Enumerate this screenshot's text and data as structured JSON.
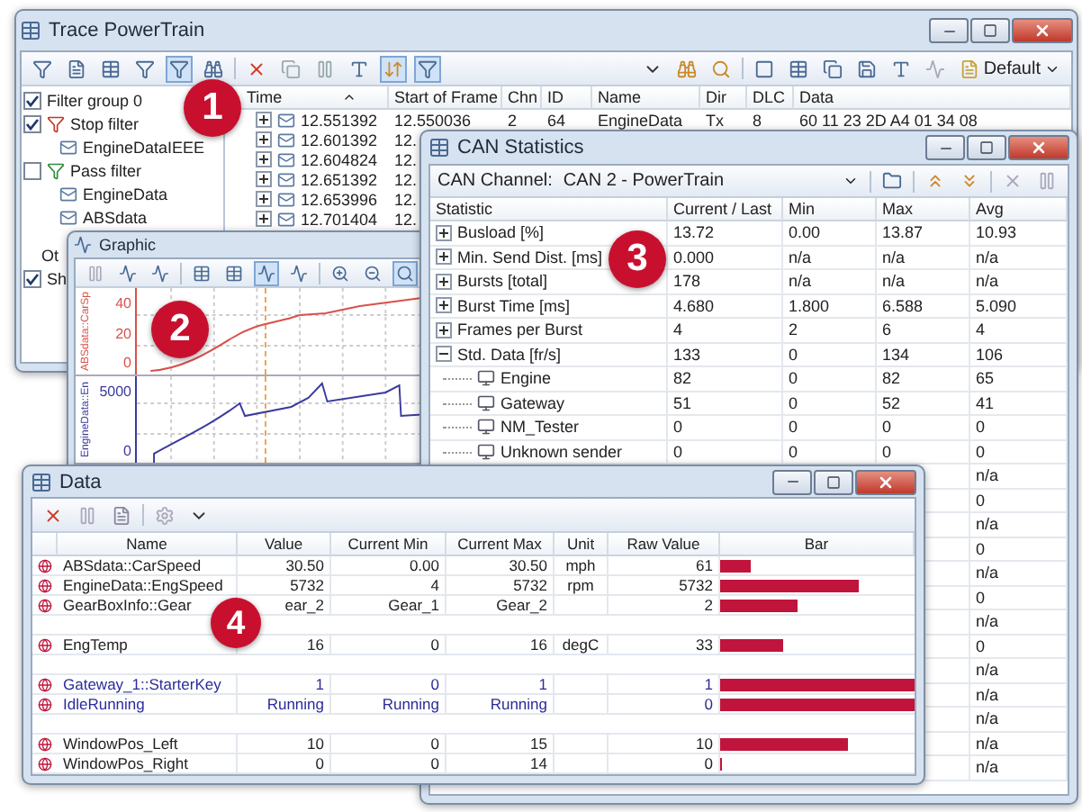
{
  "trace": {
    "title": "Trace PowerTrain",
    "view_dropdown": "Default",
    "filter_pane": {
      "group": {
        "label": "Filter group 0",
        "checked": true
      },
      "filters": [
        {
          "label": "Stop filter",
          "checked": true,
          "kind": "stop",
          "children": [
            {
              "label": "EngineDataIEEE"
            }
          ]
        },
        {
          "label": "Pass filter",
          "checked": false,
          "kind": "pass",
          "children": [
            {
              "label": "EngineData"
            },
            {
              "label": "ABSdata"
            }
          ]
        }
      ],
      "cut_label": "Ot",
      "option": {
        "label": "Sh",
        "checked": true
      }
    },
    "columns": [
      "Time",
      "Start of Frame",
      "Chn",
      "ID",
      "Name",
      "Dir",
      "DLC",
      "Data"
    ],
    "rows": [
      {
        "time": "12.551392",
        "start_of_frame": "12.550036",
        "chn": "2",
        "id": "64",
        "name": "EngineData",
        "dir": "Tx",
        "dlc": "8",
        "data": "60 11 23 2D A4 01 34 08"
      },
      {
        "time": "12.601392",
        "start_of_frame": "12."
      },
      {
        "time": "12.604824",
        "start_of_frame": "12."
      },
      {
        "time": "12.651392",
        "start_of_frame": "12."
      },
      {
        "time": "12.653996",
        "start_of_frame": "12."
      },
      {
        "time": "12.701404",
        "start_of_frame": "12."
      }
    ]
  },
  "graphic": {
    "title": "Graphic",
    "panes": [
      {
        "signal": "ABSdata::CarSp",
        "color": "#d9504a",
        "ticks": [
          "40",
          "20",
          "0"
        ]
      },
      {
        "signal": "EngineData::En",
        "color": "#3a3a9e",
        "ticks": [
          "5000",
          "0"
        ]
      }
    ]
  },
  "can_statistics": {
    "title": "CAN Statistics",
    "channel_label": "CAN Channel:",
    "channel": "CAN 2 - PowerTrain",
    "columns": [
      "Statistic",
      "Current / Last",
      "Min",
      "Max",
      "Avg"
    ],
    "rows": [
      {
        "statistic": "Busload [%]",
        "current": "13.72",
        "min": "0.00",
        "max": "13.87",
        "avg": "10.93",
        "expanded": false
      },
      {
        "statistic": "Min. Send Dist. [ms]",
        "current": "0.000",
        "min": "n/a",
        "max": "n/a",
        "avg": "n/a",
        "expanded": false
      },
      {
        "statistic": "Bursts [total]",
        "current": "178",
        "min": "n/a",
        "max": "n/a",
        "avg": "n/a",
        "expanded": false
      },
      {
        "statistic": "Burst Time [ms]",
        "current": "4.680",
        "min": "1.800",
        "max": "6.588",
        "avg": "5.090",
        "expanded": false
      },
      {
        "statistic": "Frames per Burst",
        "current": "4",
        "min": "2",
        "max": "6",
        "avg": "4",
        "expanded": false
      },
      {
        "statistic": "Std. Data [fr/s]",
        "current": "133",
        "min": "0",
        "max": "134",
        "avg": "106",
        "expanded": true,
        "children": [
          {
            "statistic": "Engine",
            "current": "82",
            "min": "0",
            "max": "82",
            "avg": "65"
          },
          {
            "statistic": "Gateway",
            "current": "51",
            "min": "0",
            "max": "52",
            "avg": "41"
          },
          {
            "statistic": "NM_Tester",
            "current": "0",
            "min": "0",
            "max": "0",
            "avg": "0"
          },
          {
            "statistic": "Unknown sender",
            "current": "0",
            "min": "0",
            "max": "0",
            "avg": "0"
          }
        ]
      },
      {
        "avg": "n/a"
      },
      {
        "avg": "0"
      },
      {
        "avg": "n/a"
      },
      {
        "avg": "0"
      },
      {
        "avg": "n/a"
      },
      {
        "avg": "0"
      },
      {
        "avg": "n/a"
      },
      {
        "avg": "0"
      },
      {
        "avg": "n/a"
      },
      {
        "avg": "n/a"
      },
      {
        "avg": "n/a"
      },
      {
        "avg": "n/a"
      },
      {
        "avg": "n/a"
      }
    ]
  },
  "data": {
    "title": "Data",
    "columns": [
      "Name",
      "Value",
      "Current Min",
      "Current Max",
      "Unit",
      "Raw Value",
      "Bar"
    ],
    "rows": [
      {
        "kind": "signal",
        "name": "ABSdata::CarSpeed",
        "value": "30.50",
        "min": "0.00",
        "max": "30.50",
        "unit": "mph",
        "raw": "61",
        "level": 0.16
      },
      {
        "kind": "signal",
        "name": "EngineData::EngSpeed",
        "value": "5732",
        "min": "4",
        "max": "5732",
        "unit": "rpm",
        "raw": "5732",
        "level": 0.71
      },
      {
        "kind": "signal",
        "name": "GearBoxInfo::Gear",
        "value": "ear_2",
        "min": "Gear_1",
        "max": "Gear_2",
        "raw": "2",
        "level": 0.4
      },
      {
        "kind": "spacer"
      },
      {
        "kind": "signal",
        "name": "EngTemp",
        "value": "16",
        "min": "0",
        "max": "16",
        "unit": "degC",
        "raw": "33",
        "level": 0.32
      },
      {
        "kind": "spacer"
      },
      {
        "kind": "variable",
        "name": "Gateway_1::StarterKey",
        "value": "1",
        "min": "0",
        "max": "1",
        "raw": "1",
        "level": 1
      },
      {
        "kind": "variable",
        "name": "IdleRunning",
        "value": "Running",
        "min": "Running",
        "max": "Running",
        "raw": "0",
        "level": 1
      },
      {
        "kind": "spacer"
      },
      {
        "kind": "signal",
        "name": "WindowPos_Left",
        "value": "10",
        "min": "0",
        "max": "15",
        "raw": "10",
        "level": 0.66
      },
      {
        "kind": "signal",
        "name": "WindowPos_Right",
        "value": "0",
        "min": "0",
        "max": "14",
        "raw": "0",
        "level": 0
      }
    ]
  },
  "badges": [
    "1",
    "2",
    "3",
    "4"
  ]
}
